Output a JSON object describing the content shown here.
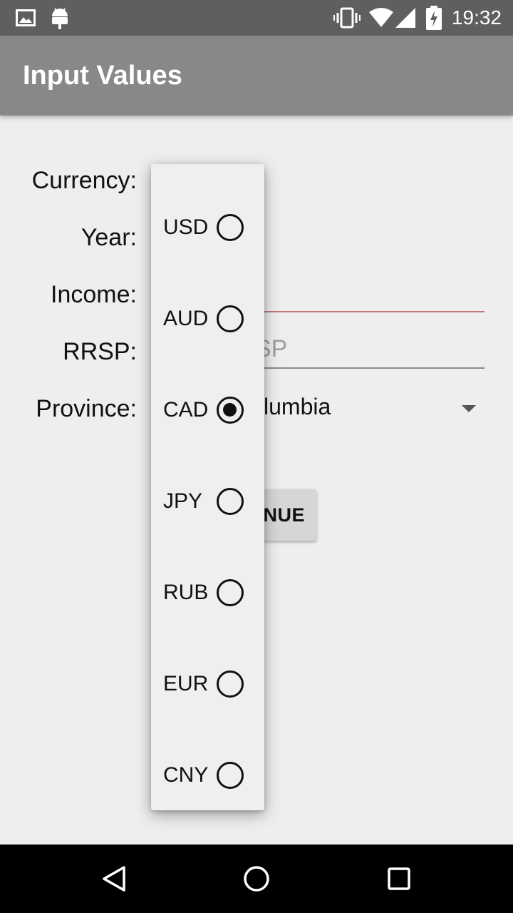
{
  "status_bar": {
    "time": "19:32",
    "icons": [
      "image-icon",
      "android-icon",
      "vibrate-icon",
      "wifi-icon",
      "signal-icon",
      "battery-charging-icon"
    ]
  },
  "app_bar": {
    "title": "Input Values"
  },
  "form": {
    "labels": {
      "currency": "Currency:",
      "year": "Year:",
      "income": "Income:",
      "rrsp": "RRSP:",
      "province": "Province:"
    },
    "rrsp_placeholder_visible": "SP",
    "province_value_visible": "lumbia",
    "continue_label_visible": "NUE",
    "income_underline_color": "#c97474",
    "rrsp_underline_color": "#8a8a8a"
  },
  "currency_popup": {
    "options": [
      "USD",
      "AUD",
      "CAD",
      "JPY",
      "RUB",
      "EUR",
      "CNY"
    ],
    "selected": "CAD"
  },
  "nav_bar": {
    "icons": [
      "back-icon",
      "home-icon",
      "recents-icon"
    ]
  }
}
